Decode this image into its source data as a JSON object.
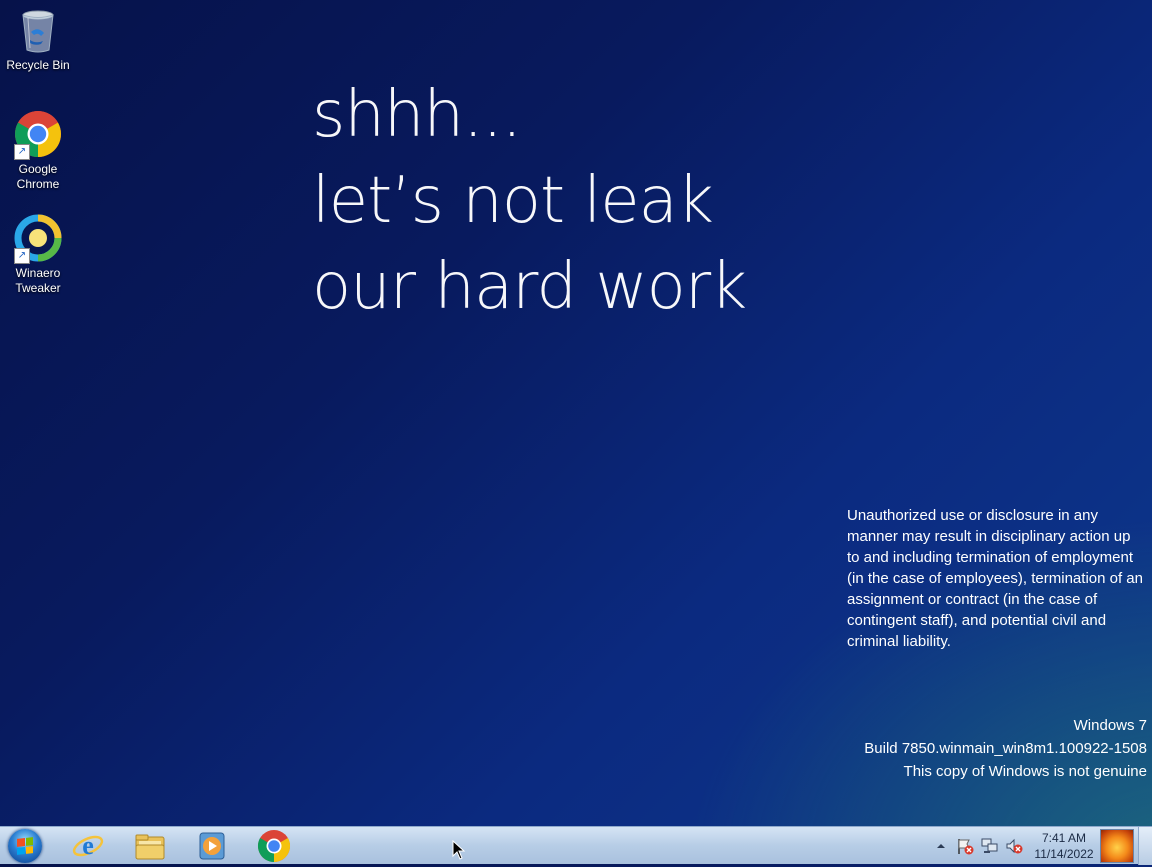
{
  "desktop": {
    "icons": [
      {
        "label": "Recycle Bin",
        "icon": "recycle-bin-icon"
      },
      {
        "label": "Google\nChrome",
        "label_lines": [
          "Google",
          "Chrome"
        ],
        "icon": "chrome-icon"
      },
      {
        "label_lines": [
          "Winaero",
          "Tweaker"
        ],
        "icon": "winaero-tweaker-icon"
      }
    ]
  },
  "wallpaper": {
    "headline": [
      "shhh...",
      "let’s not leak",
      "our hard work"
    ],
    "legal_notice": "Unauthorized use or disclosure in any manner may result in disciplinary action up to and including termination of employment (in the case of employees), termination of an assignment or contract (in the case of contingent staff), and potential civil and criminal liability.",
    "colors": {
      "background_dark": "#06124a",
      "background_light": "#0e3a8e",
      "text": "#ffffff"
    }
  },
  "watermark": {
    "os_name": "Windows 7",
    "build": "Build 7850.winmain_win8m1.100922-1508",
    "genuine_notice": "This copy of Windows is not genuine"
  },
  "taskbar": {
    "start_icon": "windows-start-orb-icon",
    "pinned": [
      {
        "name": "internet-explorer",
        "icon": "internet-explorer-icon"
      },
      {
        "name": "windows-explorer",
        "icon": "folder-icon"
      },
      {
        "name": "windows-media-player",
        "icon": "media-player-icon"
      },
      {
        "name": "google-chrome",
        "icon": "chrome-icon"
      }
    ],
    "tray": {
      "show_hidden_icon": "up-arrow-icon",
      "icons": [
        "action-center-flag-icon",
        "network-icon",
        "volume-muted-icon"
      ],
      "time": "7:41 AM",
      "date": "11/14/2022"
    }
  }
}
